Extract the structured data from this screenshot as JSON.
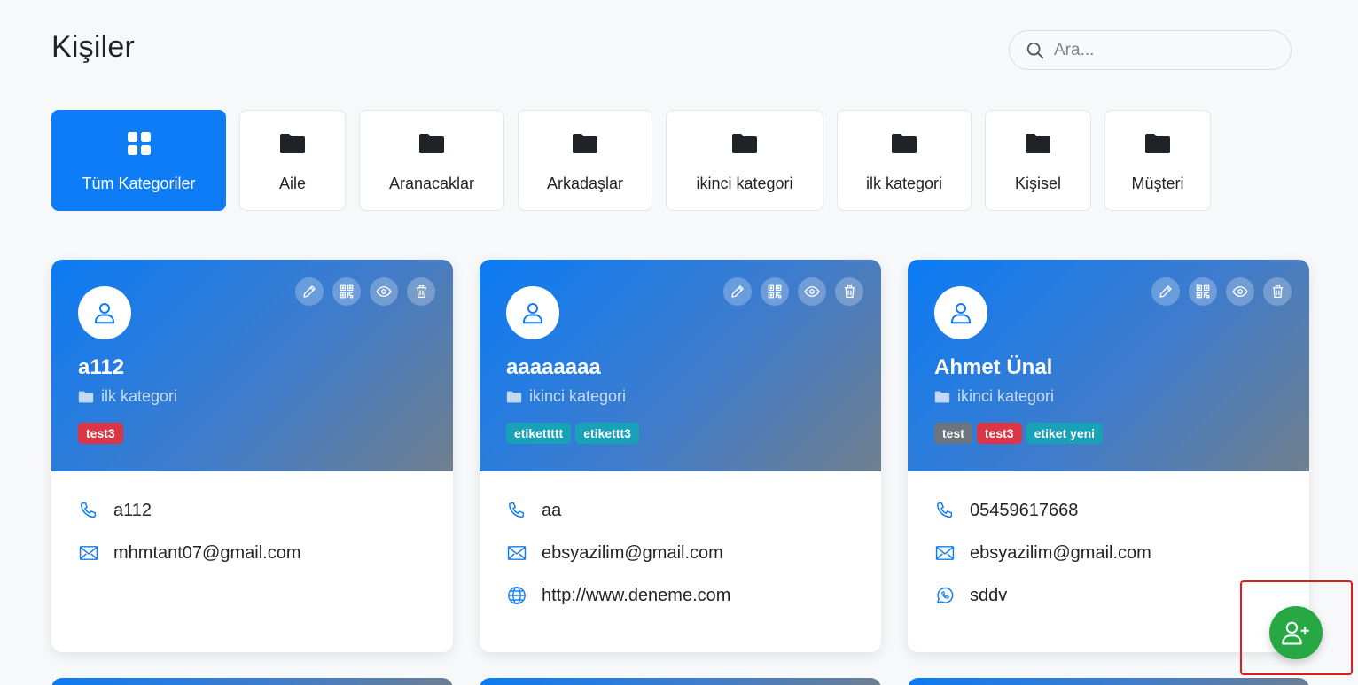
{
  "page": {
    "title": "Kişiler"
  },
  "search": {
    "placeholder": "Ara..."
  },
  "categories": [
    {
      "label": "Tüm Kategoriler",
      "active": true,
      "icon": "grid-icon"
    },
    {
      "label": "Aile",
      "icon": "folder-icon"
    },
    {
      "label": "Aranacaklar",
      "icon": "folder-icon"
    },
    {
      "label": "Arkadaşlar",
      "icon": "folder-icon"
    },
    {
      "label": "ikinci kategori",
      "icon": "folder-icon"
    },
    {
      "label": "ilk kategori",
      "icon": "folder-icon"
    },
    {
      "label": "Kişisel",
      "icon": "folder-icon"
    },
    {
      "label": "Müşteri",
      "icon": "folder-icon"
    }
  ],
  "contacts": [
    {
      "name": "a112",
      "category": "ilk kategori",
      "tags": [
        {
          "label": "test3",
          "color": "#dc3545"
        }
      ],
      "phone": "a112",
      "email": "mhmtant07@gmail.com"
    },
    {
      "name": "aaaaaaaa",
      "category": "ikinci kategori",
      "tags": [
        {
          "label": "etikettttt",
          "color": "#17a2b8"
        },
        {
          "label": "etikettt3",
          "color": "#17a2b8"
        }
      ],
      "phone": "aa",
      "email": "ebsyazilim@gmail.com",
      "website": "http://www.deneme.com"
    },
    {
      "name": "Ahmet Ünal",
      "category": "ikinci kategori",
      "tags": [
        {
          "label": "test",
          "color": "#6c757d"
        },
        {
          "label": "test3",
          "color": "#dc3545"
        },
        {
          "label": "etiket yeni",
          "color": "#17a2b8"
        }
      ],
      "phone": "05459617668",
      "email": "ebsyazilim@gmail.com",
      "whatsapp": "sddv"
    }
  ],
  "colors": {
    "primary": "#0d7cf6",
    "fab": "#28a745",
    "highlight": "#e21c1c"
  }
}
